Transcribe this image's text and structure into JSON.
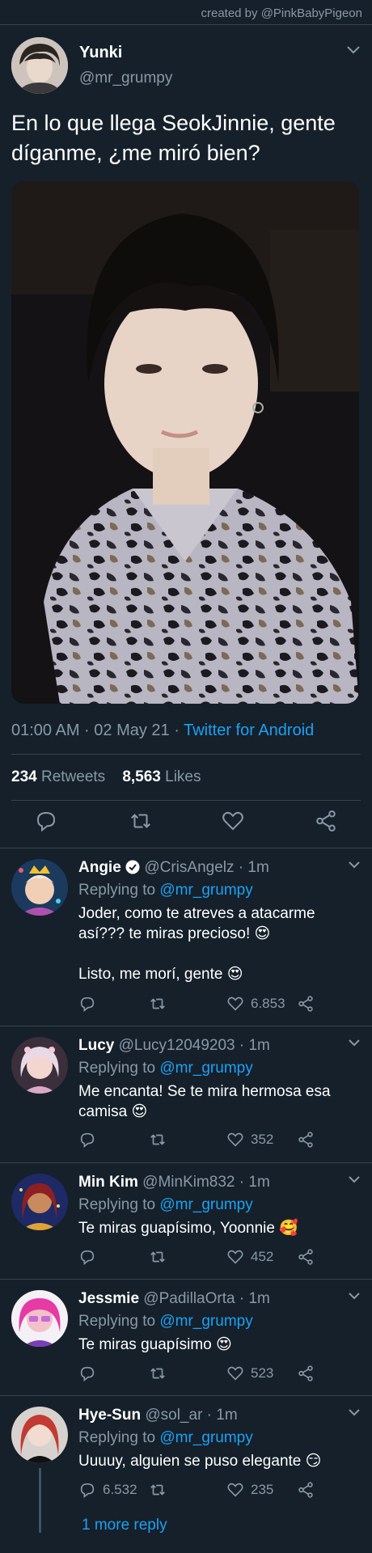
{
  "credit": "created by @PinkBabyPigeon",
  "tweet": {
    "name": "Yunki",
    "handle": "@mr_grumpy",
    "text": "En lo que llega SeokJinnie, gente díganme, ¿me miró bien?",
    "time": "01:00 AM · 02 May 21 · ",
    "source": "Twitter for Android",
    "retweets": "234",
    "retweets_label": " Retweets",
    "likes": "8,563",
    "likes_label": " Likes"
  },
  "replies": [
    {
      "name": "Angie",
      "verified": true,
      "handle": "@CrisAngelz · 1m",
      "replying": "Replying to ",
      "to": "@mr_grumpy",
      "text1": "Joder, como te atreves a atacarme así??? te miras precioso! 😍",
      "text2": "Listo, me morí, gente 😍",
      "likes": "6.853"
    },
    {
      "name": "Lucy",
      "handle": "@Lucy12049203 · 1m",
      "replying": "Replying to ",
      "to": "@mr_grumpy",
      "text1": "Me encanta! Se te mira hermosa esa camisa 😍",
      "likes": "352"
    },
    {
      "name": "Min Kim",
      "handle": "@MinKim832 · 1m",
      "replying": "Replying to ",
      "to": "@mr_grumpy",
      "text1": "Te miras guapísimo, Yoonnie 🥰",
      "likes": "452"
    },
    {
      "name": "Jessmie",
      "handle": "@PadillaOrta · 1m",
      "replying": "Replying to ",
      "to": "@mr_grumpy",
      "text1": "Te miras guapísimo 😍",
      "likes": "523"
    },
    {
      "name": "Hye-Sun",
      "handle": "@sol_ar · 1m",
      "replying": "Replying to ",
      "to": "@mr_grumpy",
      "text1": "Uuuuy, alguien se puso elegante 😏",
      "comments": "6.532",
      "likes": "235",
      "more": "1 more reply"
    }
  ],
  "colors": {
    "background": "#15202b",
    "accent": "#1da1f2",
    "muted": "#8899a6",
    "divider": "#38444d"
  },
  "icons": [
    "chevron-down-icon",
    "reply-icon",
    "retweet-icon",
    "like-icon",
    "share-icon",
    "verified-badge-icon"
  ]
}
